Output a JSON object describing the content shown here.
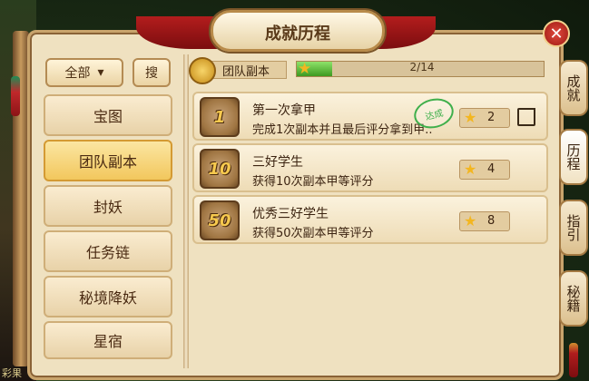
{
  "window": {
    "title": "成就历程",
    "close_symbol": "✕"
  },
  "filter": {
    "dropdown_label": "全部",
    "dropdown_caret": "▾",
    "search_label": "搜"
  },
  "categories": [
    {
      "label": "宝图",
      "active": false
    },
    {
      "label": "团队副本",
      "active": true
    },
    {
      "label": "封妖",
      "active": false
    },
    {
      "label": "任务链",
      "active": false
    },
    {
      "label": "秘境降妖",
      "active": false
    },
    {
      "label": "星宿",
      "active": false
    }
  ],
  "header": {
    "category_label": "团队副本",
    "progress_text": "2/14",
    "progress_value": 0.143,
    "progress_star": "★"
  },
  "achievements": [
    {
      "medal": "1",
      "title": "第一次拿甲",
      "desc": "完成1次副本并且最后评分拿到甲..",
      "reward": "2",
      "completed": true,
      "stamp_label": "达成",
      "star": "★"
    },
    {
      "medal": "10",
      "title": "三好学生",
      "desc": "获得10次副本甲等评分",
      "reward": "4",
      "completed": false,
      "star": "★"
    },
    {
      "medal": "50",
      "title": "优秀三好学生",
      "desc": "获得50次副本甲等评分",
      "reward": "8",
      "completed": false,
      "star": "★"
    }
  ],
  "side_tabs": [
    {
      "label": "成就",
      "active": false
    },
    {
      "label": "历程",
      "active": true
    },
    {
      "label": "指引",
      "active": false
    },
    {
      "label": "秘籍",
      "active": false
    }
  ],
  "background": {
    "bottom_text": "彩果"
  },
  "colors": {
    "accent": "#f2c75d",
    "progress_fill": "#3e9a21",
    "stamp": "#3faf4b",
    "close": "#c62f25"
  }
}
